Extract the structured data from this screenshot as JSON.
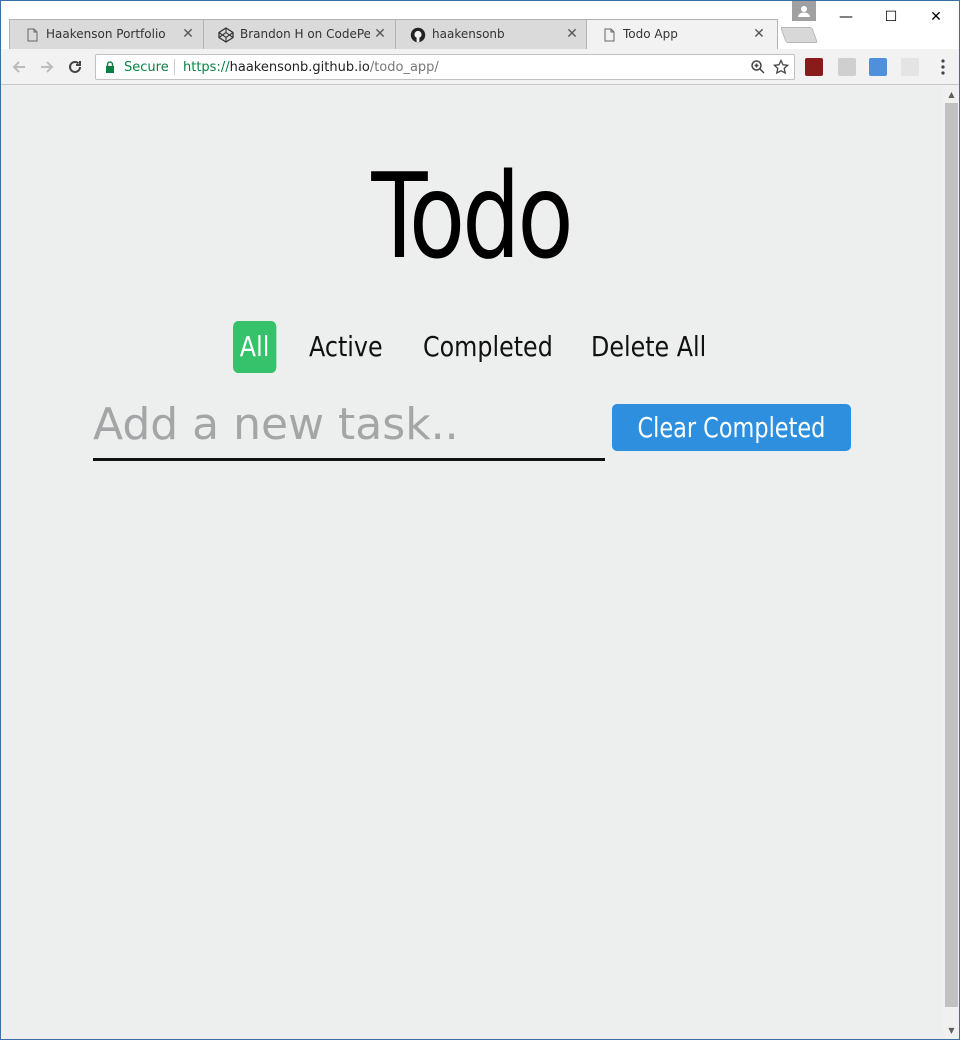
{
  "browser": {
    "tabs": [
      {
        "title": "Haakenson Portfolio",
        "icon": "page-icon"
      },
      {
        "title": "Brandon H on CodePen",
        "icon": "codepen-icon"
      },
      {
        "title": "haakensonb",
        "icon": "github-icon"
      },
      {
        "title": "Todo App",
        "icon": "page-icon",
        "active": true
      }
    ],
    "close_glyph": "✕",
    "window_controls": {
      "minimize": "—",
      "maximize": "☐",
      "close": "✕"
    },
    "secure_label": "Secure",
    "url": {
      "scheme": "https://",
      "host": "haakensonb.github.io",
      "path": "/todo_app/"
    }
  },
  "app": {
    "title": "Todo",
    "filters": [
      "All",
      "Active",
      "Completed",
      "Delete All"
    ],
    "active_filter": "All",
    "input_placeholder": "Add a new task..",
    "input_value": "",
    "clear_button": "Clear Completed"
  },
  "colors": {
    "active_filter": "#36c26a",
    "clear_button": "#2d8fdd",
    "background": "#edeeee",
    "secure_green": "#0b8043"
  }
}
